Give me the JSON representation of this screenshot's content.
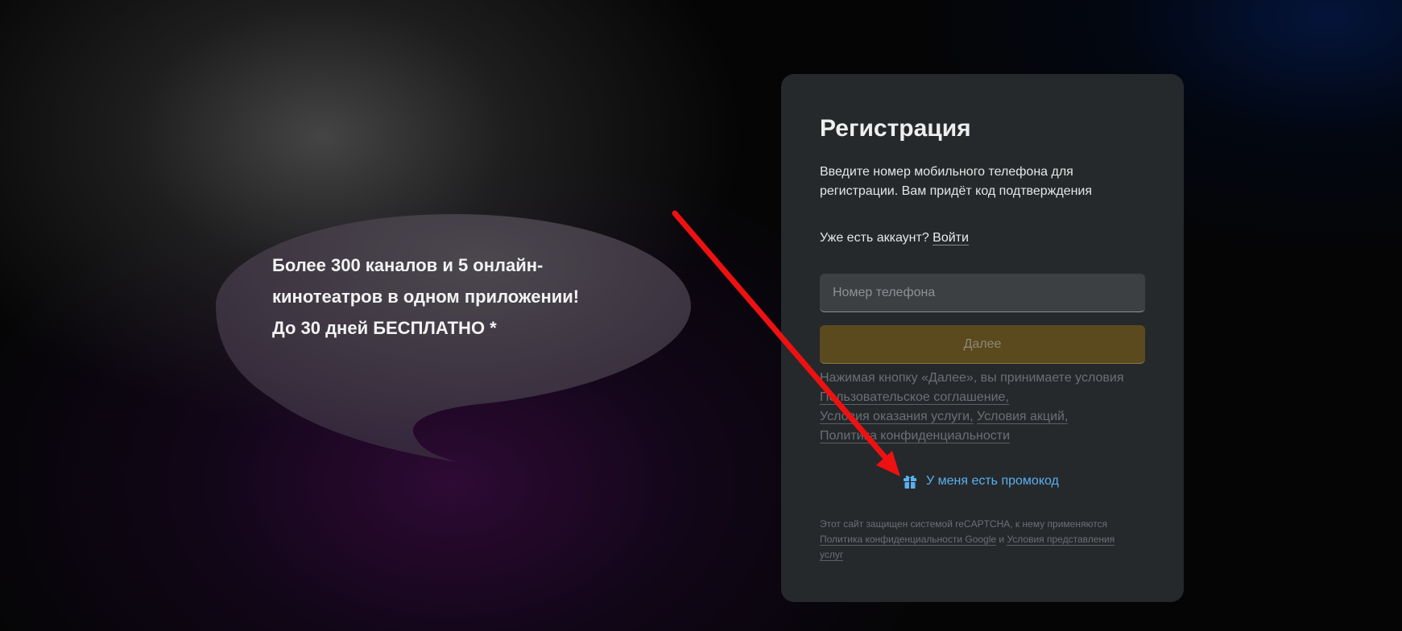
{
  "promo_bubble": {
    "lines": [
      "Более 300 каналов и 5 онлайн-",
      "кинотеатров в одном приложении!",
      "До 30 дней БЕСПЛАТНО *"
    ]
  },
  "registration": {
    "title": "Регистрация",
    "description_lines": [
      "Введите номер мобильного телефона для",
      "регистрации. Вам придёт код подтверждения"
    ],
    "have_account_text": "Уже есть аккаунт?",
    "login_link": "Войти",
    "phone_placeholder": "Номер телефона",
    "phone_value": "",
    "next_button": "Далее",
    "terms_intro": "Нажимая кнопку «Далее», вы принимаете условия",
    "terms_links": {
      "user_agreement": "Пользовательское соглашение,",
      "service_terms": "Условия оказания услуги,",
      "promo_terms": "Условия акций,",
      "privacy_policy": "Политика конфиденциальности"
    },
    "promo_code_link": "У меня есть промокод",
    "recaptcha": {
      "intro": "Этот сайт защищен системой reCAPTCHA, к нему применяются",
      "google_privacy": "Политика конфиденциальности Google",
      "and": "и",
      "service_terms": "Условия представления",
      "service_terms_cont": "услуг"
    }
  },
  "colors": {
    "card_bg": "#25292c",
    "accent_gold": "#5a4a1e",
    "promo_link": "#5ab0ee",
    "annotation_arrow": "#ee1111"
  },
  "icons": {
    "promo": "gift-icon"
  }
}
